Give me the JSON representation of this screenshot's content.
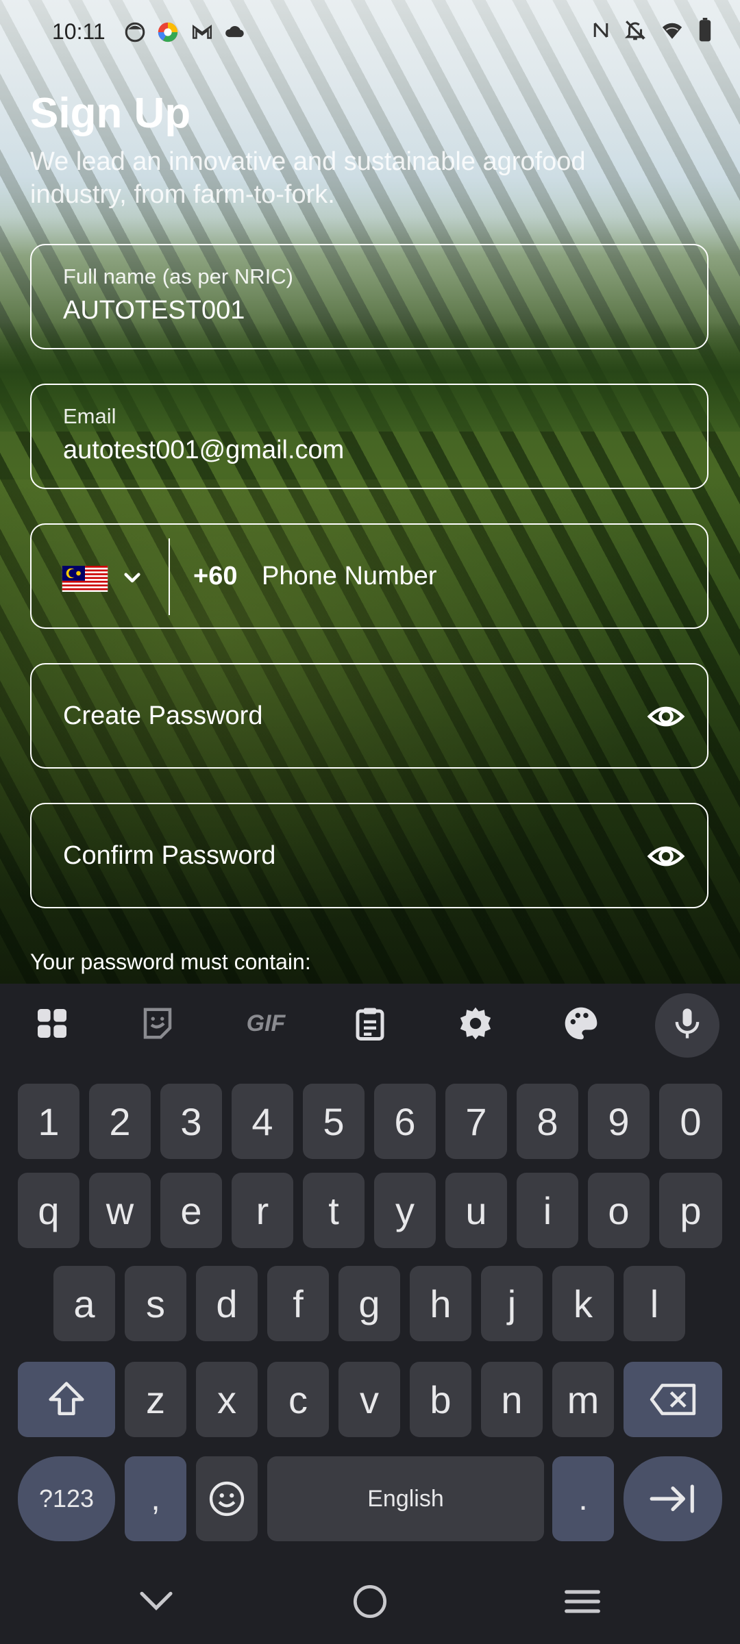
{
  "status_bar": {
    "time": "10:11",
    "left_icons": [
      "face-icon",
      "chrome-like-icon",
      "gmail-icon",
      "cloud-icon"
    ],
    "right_icons": [
      "nfc-icon",
      "bell-off-icon",
      "wifi-icon",
      "battery-icon"
    ]
  },
  "header": {
    "title": "Sign Up",
    "subtitle": "We lead an innovative and sustainable agrofood industry, from farm-to-fork."
  },
  "form": {
    "full_name": {
      "label": "Full name (as per NRIC)",
      "value": "AUTOTEST001"
    },
    "email": {
      "label": "Email",
      "value": "autotest001@gmail.com"
    },
    "phone": {
      "country_code": "+60",
      "placeholder": "Phone Number",
      "flag": "malaysia-flag-icon"
    },
    "create_password": {
      "placeholder": "Create Password"
    },
    "confirm_password": {
      "placeholder": "Confirm Password"
    },
    "password_hint": "Your password must contain:"
  },
  "keyboard": {
    "toolbar": [
      "apps-grid-icon",
      "sticker-icon",
      "gif-icon",
      "clipboard-icon",
      "settings-icon",
      "palette-icon",
      "mic-icon"
    ],
    "gif_label": "GIF",
    "row_numbers": [
      "1",
      "2",
      "3",
      "4",
      "5",
      "6",
      "7",
      "8",
      "9",
      "0"
    ],
    "row1": [
      "q",
      "w",
      "e",
      "r",
      "t",
      "y",
      "u",
      "i",
      "o",
      "p"
    ],
    "row2": [
      "a",
      "s",
      "d",
      "f",
      "g",
      "h",
      "j",
      "k",
      "l"
    ],
    "row3": [
      "z",
      "x",
      "c",
      "v",
      "b",
      "n",
      "m"
    ],
    "symbols_label": "?123",
    "comma_label": ",",
    "space_label": "English",
    "period_label": ".",
    "colors": {
      "bg": "#1f2025",
      "key": "#3b3c42",
      "alt_key": "#4a5168"
    }
  },
  "nav_bar": [
    "chevron-down-icon",
    "home-circle-icon",
    "menu-lines-icon"
  ]
}
